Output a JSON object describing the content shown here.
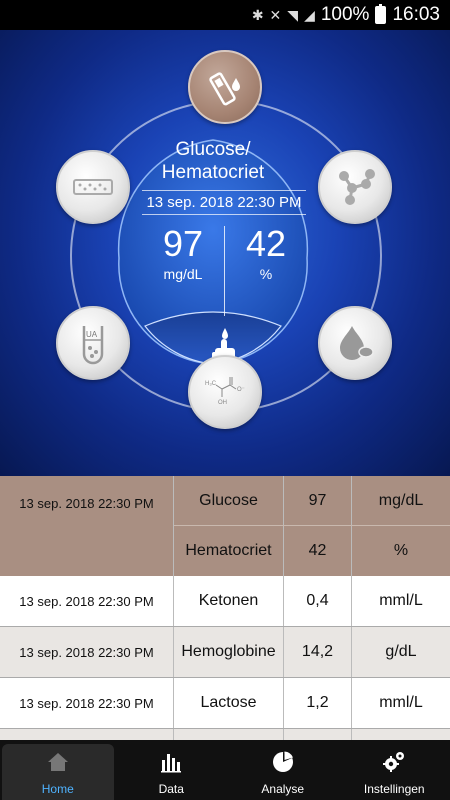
{
  "status_bar": {
    "battery": "100%",
    "time": "16:03",
    "icons": [
      "bluetooth-icon",
      "mute-icon",
      "wifi-icon",
      "signal-icon",
      "battery-icon"
    ]
  },
  "hero": {
    "title_line1": "Glucose/",
    "title_line2": "Hematocriet",
    "date": "13 sep. 2018 22:30 PM",
    "left_value": "97",
    "left_unit": "mg/dL",
    "right_value": "42",
    "right_unit": "%",
    "bubbles": [
      {
        "name": "glucose-strip-icon",
        "active": true
      },
      {
        "name": "molecule-icon",
        "active": false
      },
      {
        "name": "blood-drop-icon",
        "active": false
      },
      {
        "name": "lactate-formula-icon",
        "active": false
      },
      {
        "name": "uric-acid-tube-icon",
        "active": false
      },
      {
        "name": "test-strip-icon",
        "active": false
      }
    ],
    "lactate_formula": {
      "a": "H₃C",
      "b": "OH",
      "c": "O⁻"
    },
    "uric_label": "UA"
  },
  "table": {
    "rows": [
      {
        "date": "13 sep. 2018 22:30 PM",
        "name": "Glucose",
        "value": "97",
        "unit": "mg/dL"
      },
      {
        "date": "",
        "name": "Hematocriet",
        "value": "42",
        "unit": "%"
      },
      {
        "date": "13 sep. 2018 22:30 PM",
        "name": "Ketonen",
        "value": "0,4",
        "unit": "mml/L"
      },
      {
        "date": "13 sep. 2018 22:30 PM",
        "name": "Hemoglobine",
        "value": "14,2",
        "unit": "g/dL"
      },
      {
        "date": "13 sep. 2018 22:30 PM",
        "name": "Lactose",
        "value": "1,2",
        "unit": "mml/L"
      }
    ]
  },
  "nav": {
    "items": [
      {
        "label": "Home",
        "icon": "home-icon",
        "active": true
      },
      {
        "label": "Data",
        "icon": "bar-chart-icon",
        "active": false
      },
      {
        "label": "Analyse",
        "icon": "pie-chart-icon",
        "active": false
      },
      {
        "label": "Instellingen",
        "icon": "gears-icon",
        "active": false
      }
    ]
  },
  "colors": {
    "active_row": "#a98f82",
    "alt_row": "#e9e6e3",
    "nav_active": "#4fb3ff",
    "hero_blue": "#1a43b5"
  }
}
